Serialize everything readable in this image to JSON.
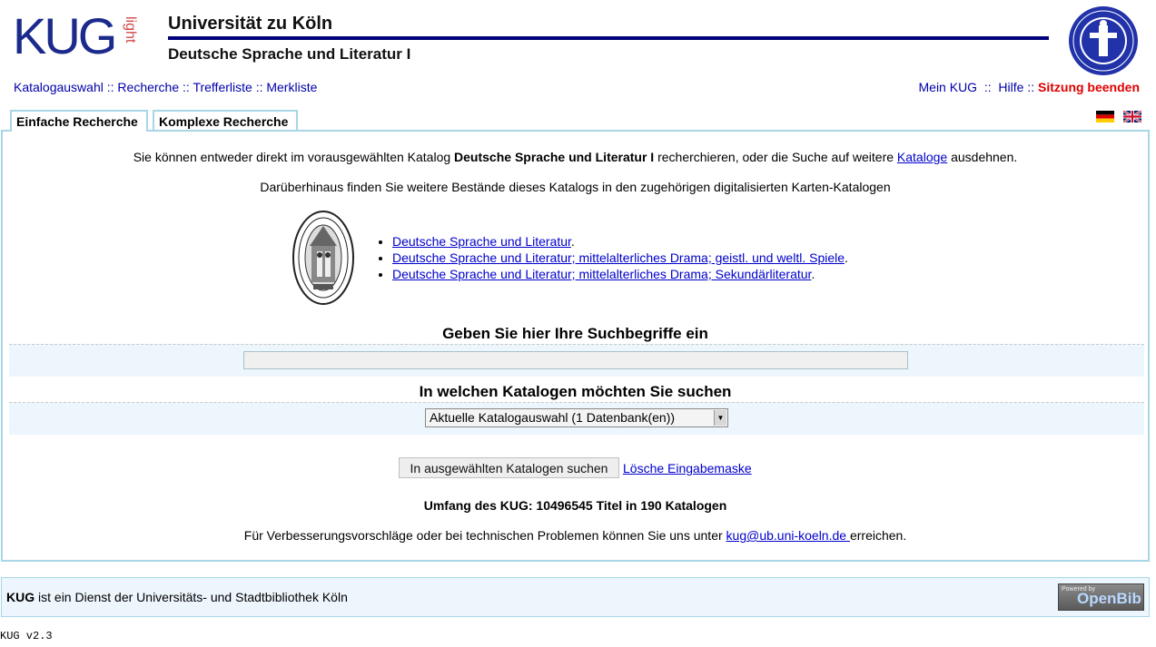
{
  "header": {
    "logo_kug": "KUG",
    "logo_light": "light",
    "uni_title": "Universität zu Köln",
    "catalog_title": "Deutsche Sprache und Literatur I"
  },
  "nav_left": {
    "catalog_selection": "Katalogauswahl",
    "search": "Recherche",
    "results": "Trefferliste",
    "notes": "Merkliste",
    "sep": "::"
  },
  "nav_right": {
    "my_kug": "Mein KUG",
    "help": "Hilfe",
    "logout": "Sitzung beenden",
    "sep": "::"
  },
  "tabs": {
    "simple": "Einfache Recherche",
    "complex": "Komplexe Recherche"
  },
  "intro": {
    "part1": "Sie können entweder direkt im vorausgewählten Katalog ",
    "catalog": "Deutsche Sprache und Literatur I",
    "part2": " recherchieren, oder die Suche auf weitere ",
    "link": "Kataloge",
    "part3": " ausdehnen.",
    "line2": "Darüberhinaus finden Sie weitere Bestände dieses Katalogs in den zugehörigen digitalisierten Karten-Katalogen"
  },
  "card_catalogs": [
    {
      "label": "Deutsche Sprache und Literatur",
      "suffix": "."
    },
    {
      "label": "Deutsche Sprache und Literatur; mittelalterliches Drama; geistl. und weltl. Spiele",
      "suffix": "."
    },
    {
      "label": "Deutsche Sprache und Literatur; mittelalterliches Drama; Sekundärliteratur",
      "suffix": "."
    }
  ],
  "search": {
    "heading": "Geben Sie hier Ihre Suchbegriffe ein",
    "value": ""
  },
  "catalogs": {
    "heading": "In welchen Katalogen möchten Sie suchen",
    "selected": "Aktuelle Katalogauswahl (1 Datenbank(en))"
  },
  "actions": {
    "search_button": "In ausgewählten Katalogen suchen",
    "clear_link": "Lösche Eingabemaske"
  },
  "scope": "Umfang des KUG: 10496545 Titel in 190 Katalogen",
  "feedback": {
    "before": "Für Verbesserungsvorschläge oder bei technischen Problemen können Sie uns unter ",
    "email": "kug@ub.uni-koeln.de ",
    "after": "erreichen."
  },
  "footer": {
    "kug": "KUG",
    "text": " ist ein Dienst der Universitäts- und Stadtbibliothek Köln",
    "badge_powered": "Powered by",
    "badge_name": "OpenBib"
  },
  "version": "KUG v2.3",
  "colors": {
    "brand_blue": "#00007a",
    "link_blue": "#0000aa",
    "logout_red": "#e00000",
    "panel_border": "#a9d6e6",
    "band_bg": "#eef6fd"
  }
}
